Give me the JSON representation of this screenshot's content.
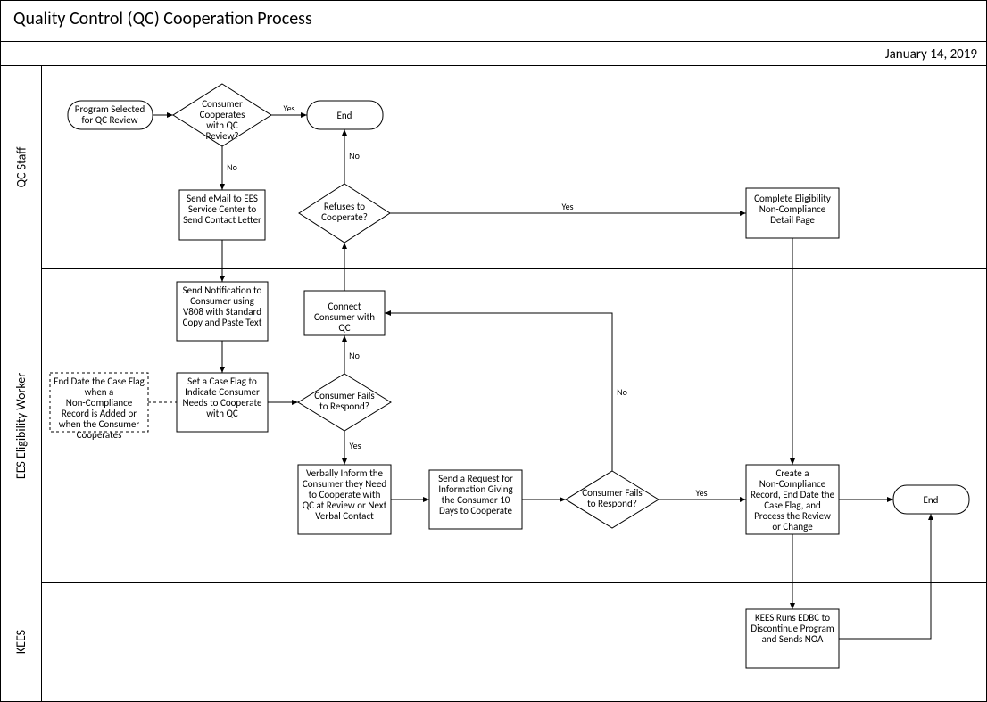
{
  "title": "Quality Control (QC) Cooperation Process",
  "date": "January 14, 2019",
  "lanes": {
    "l1": "QC Staff",
    "l2": "EES Eligibility Worker",
    "l3": "KEES"
  },
  "nodes": {
    "start": "Program Selected for QC  Review",
    "d1": "Consumer Cooperates with QC Review?",
    "end1": "End",
    "p1": "Send eMail to EES Service Center to Send Contact Letter",
    "d2": "Refuses to Cooperate?",
    "p2": "Complete Eligibility Non-Compliance Detail Page",
    "p3": "Send Notification to Consumer using V808 with Standard Copy and Paste Text",
    "p4": "Set a Case Flag to Indicate Consumer Needs to Cooperate with QC",
    "note": "End Date the Case Flag when a Non-Compliance Record is Added or when the Consumer Cooperates",
    "p5": "Connect Consumer with QC",
    "d3": "Consumer Fails to Respond?",
    "p6": "Verbally Inform the Consumer they Need to Cooperate with QC at Review or Next Verbal Contact",
    "p7": "Send a Request for Information Giving the Consumer 10 Days to Cooperate",
    "d4": "Consumer Fails to Respond?",
    "p8": "Create a Non-Compliance Record, End Date the Case Flag, and Process the Review or Change",
    "end2": "End",
    "p9": "KEES Runs EDBC to Discontinue Program and Sends NOA"
  },
  "labels": {
    "yes": "Yes",
    "no": "No"
  },
  "chart_data": {
    "type": "swimlane-flowchart",
    "title": "Quality Control (QC) Cooperation Process",
    "lanes": [
      "QC Staff",
      "EES Eligibility Worker",
      "KEES"
    ],
    "nodes": [
      {
        "id": "start",
        "lane": "QC Staff",
        "type": "terminator",
        "text": "Program Selected for QC Review"
      },
      {
        "id": "d1",
        "lane": "QC Staff",
        "type": "decision",
        "text": "Consumer Cooperates with QC Review?"
      },
      {
        "id": "end1",
        "lane": "QC Staff",
        "type": "terminator",
        "text": "End"
      },
      {
        "id": "p1",
        "lane": "QC Staff",
        "type": "process",
        "text": "Send eMail to EES Service Center to Send Contact Letter"
      },
      {
        "id": "d2",
        "lane": "QC Staff",
        "type": "decision",
        "text": "Refuses to Cooperate?"
      },
      {
        "id": "p2",
        "lane": "QC Staff",
        "type": "process",
        "text": "Complete Eligibility Non-Compliance Detail Page"
      },
      {
        "id": "p3",
        "lane": "EES Eligibility Worker",
        "type": "process",
        "text": "Send Notification to Consumer using V808 with Standard Copy and Paste Text"
      },
      {
        "id": "p4",
        "lane": "EES Eligibility Worker",
        "type": "process",
        "text": "Set a Case Flag to Indicate Consumer Needs to Cooperate with QC"
      },
      {
        "id": "note",
        "lane": "EES Eligibility Worker",
        "type": "annotation",
        "text": "End Date the Case Flag when a Non-Compliance Record is Added or when the Consumer Cooperates"
      },
      {
        "id": "p5",
        "lane": "EES Eligibility Worker",
        "type": "process",
        "text": "Connect Consumer with QC"
      },
      {
        "id": "d3",
        "lane": "EES Eligibility Worker",
        "type": "decision",
        "text": "Consumer Fails to Respond?"
      },
      {
        "id": "p6",
        "lane": "EES Eligibility Worker",
        "type": "process",
        "text": "Verbally Inform the Consumer they Need to Cooperate with QC at Review or Next Verbal Contact"
      },
      {
        "id": "p7",
        "lane": "EES Eligibility Worker",
        "type": "process",
        "text": "Send a Request for Information Giving the Consumer 10 Days to Cooperate"
      },
      {
        "id": "d4",
        "lane": "EES Eligibility Worker",
        "type": "decision",
        "text": "Consumer Fails to Respond?"
      },
      {
        "id": "p8",
        "lane": "EES Eligibility Worker",
        "type": "process",
        "text": "Create a Non-Compliance Record, End Date the Case Flag, and Process the Review or Change"
      },
      {
        "id": "end2",
        "lane": "EES Eligibility Worker",
        "type": "terminator",
        "text": "End"
      },
      {
        "id": "p9",
        "lane": "KEES",
        "type": "process",
        "text": "KEES Runs EDBC to Discontinue Program and Sends NOA"
      }
    ],
    "edges": [
      {
        "from": "start",
        "to": "d1"
      },
      {
        "from": "d1",
        "to": "end1",
        "label": "Yes"
      },
      {
        "from": "d1",
        "to": "p1",
        "label": "No"
      },
      {
        "from": "p1",
        "to": "p3"
      },
      {
        "from": "p3",
        "to": "p4"
      },
      {
        "from": "p4",
        "to": "d3"
      },
      {
        "from": "d3",
        "to": "p5",
        "label": "No"
      },
      {
        "from": "p5",
        "to": "d2"
      },
      {
        "from": "d2",
        "to": "end1",
        "label": "No"
      },
      {
        "from": "d2",
        "to": "p2",
        "label": "Yes"
      },
      {
        "from": "d3",
        "to": "p6",
        "label": "Yes"
      },
      {
        "from": "p6",
        "to": "p7"
      },
      {
        "from": "p7",
        "to": "d4"
      },
      {
        "from": "d4",
        "to": "p5",
        "label": "No"
      },
      {
        "from": "d4",
        "to": "p8",
        "label": "Yes"
      },
      {
        "from": "p2",
        "to": "p8"
      },
      {
        "from": "p8",
        "to": "end2"
      },
      {
        "from": "p8",
        "to": "p9"
      },
      {
        "from": "p9",
        "to": "end2"
      },
      {
        "from": "note",
        "to": "p4"
      }
    ]
  }
}
